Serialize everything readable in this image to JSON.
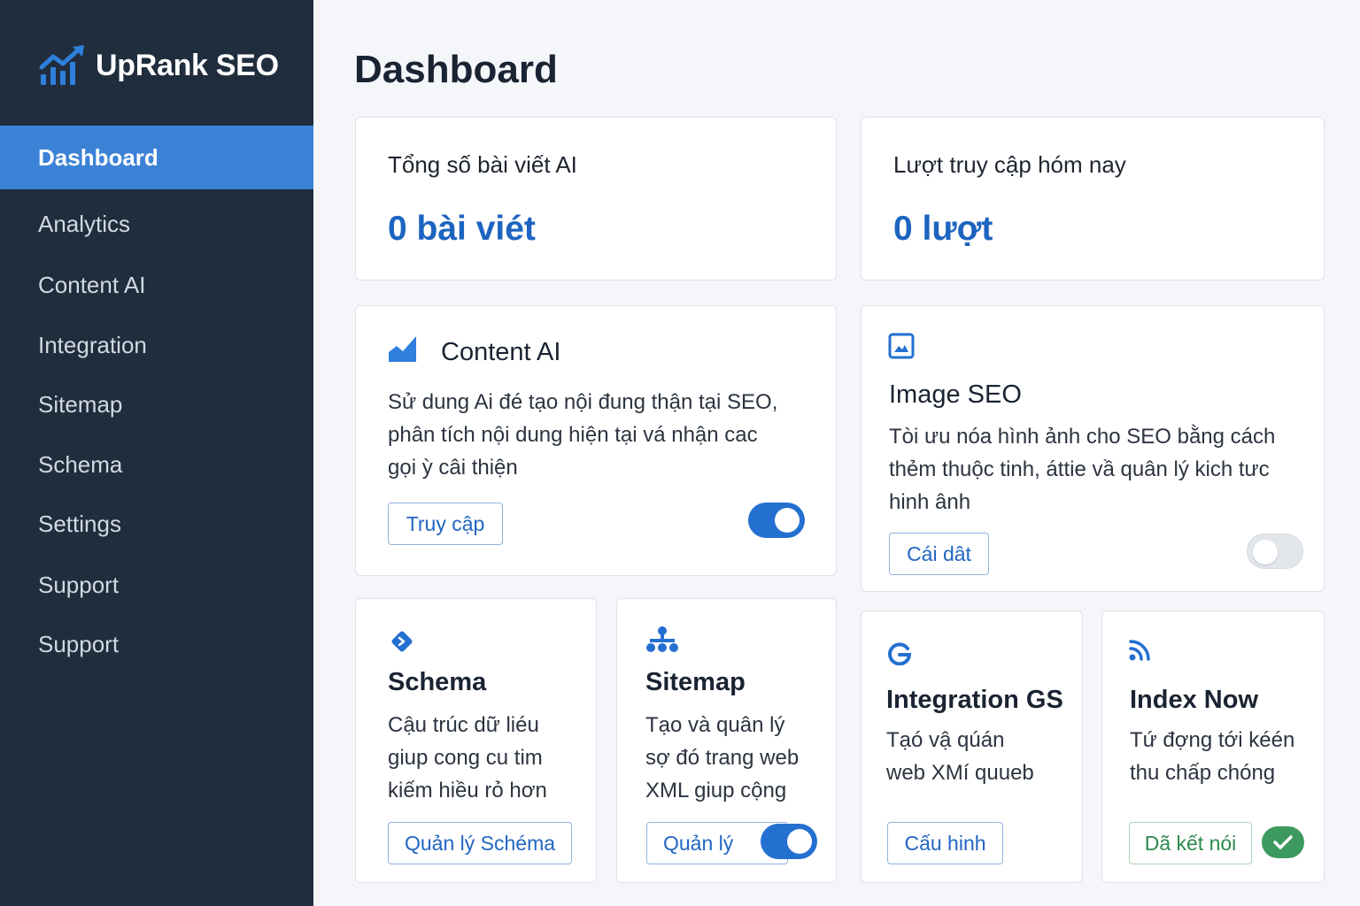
{
  "brand": {
    "name": "UpRank SEO",
    "icon": "trend-chart-icon"
  },
  "sidebar": {
    "items": [
      {
        "label": "Dashboard",
        "active": true
      },
      {
        "label": "Analytics"
      },
      {
        "label": "Content AI"
      },
      {
        "label": "Integration"
      },
      {
        "label": "Sitemap"
      },
      {
        "label": "Schema"
      },
      {
        "label": "Settings"
      },
      {
        "label": "Support"
      },
      {
        "label": "Support"
      }
    ]
  },
  "page": {
    "title": "Dashboard"
  },
  "stats": [
    {
      "label": "Tổng số bài viết AI",
      "value": "0 bài viét"
    },
    {
      "label": "Lượt truy cập hóm nay",
      "value": "0 lượt"
    }
  ],
  "cards": {
    "content_ai": {
      "title": "Content AI",
      "desc": [
        "Sử dung Ai đé tạo nội đung thận tại SEO,",
        "phân tích nội dung hiện tại vá nhận cac",
        "gọi ỳ câi thiện"
      ],
      "button": "Truy cập",
      "toggle": "on",
      "icon": "area-chart-icon"
    },
    "image_seo": {
      "title": "Image SEO",
      "desc": [
        "Tòi ưu nóa hình ảnh cho SEO bằng cách",
        "thẻm thuộc tinh, áttie vầ quân lý kich tưc",
        "hinh ânh"
      ],
      "button": "Cái dât",
      "toggle": "off",
      "icon": "image-icon"
    },
    "schema": {
      "title": "Schema",
      "desc": [
        "Cậu trúc dữ liéu",
        "giup cong cu tim",
        "kiếm hiều rỏ hơn"
      ],
      "button": "Quản lý Schéma",
      "icon": "schema-diamond-icon"
    },
    "sitemap": {
      "title": "Sitemap",
      "desc": [
        "Tạo và quân lý",
        "sợ đó trang web",
        "XML giup cộng"
      ],
      "button": "Quản lý",
      "toggle": "on",
      "icon": "sitemap-icon"
    },
    "integration_gs": {
      "title": "Integration GS",
      "desc": [
        "Tạó vậ qúán",
        "web XMí quueb"
      ],
      "button": "Cấu hinh",
      "icon": "google-icon"
    },
    "index_now": {
      "title": "Index Now",
      "desc": [
        "Tứ đợng tới kéén",
        "thu chấp chóng"
      ],
      "button": "Dã kết nói",
      "status": "connected",
      "icon": "rss-icon"
    }
  },
  "colors": {
    "sidebar": "#1f2d3d",
    "accent": "#3b82d6",
    "link": "#1d64c0",
    "success": "#3c9a5f"
  }
}
